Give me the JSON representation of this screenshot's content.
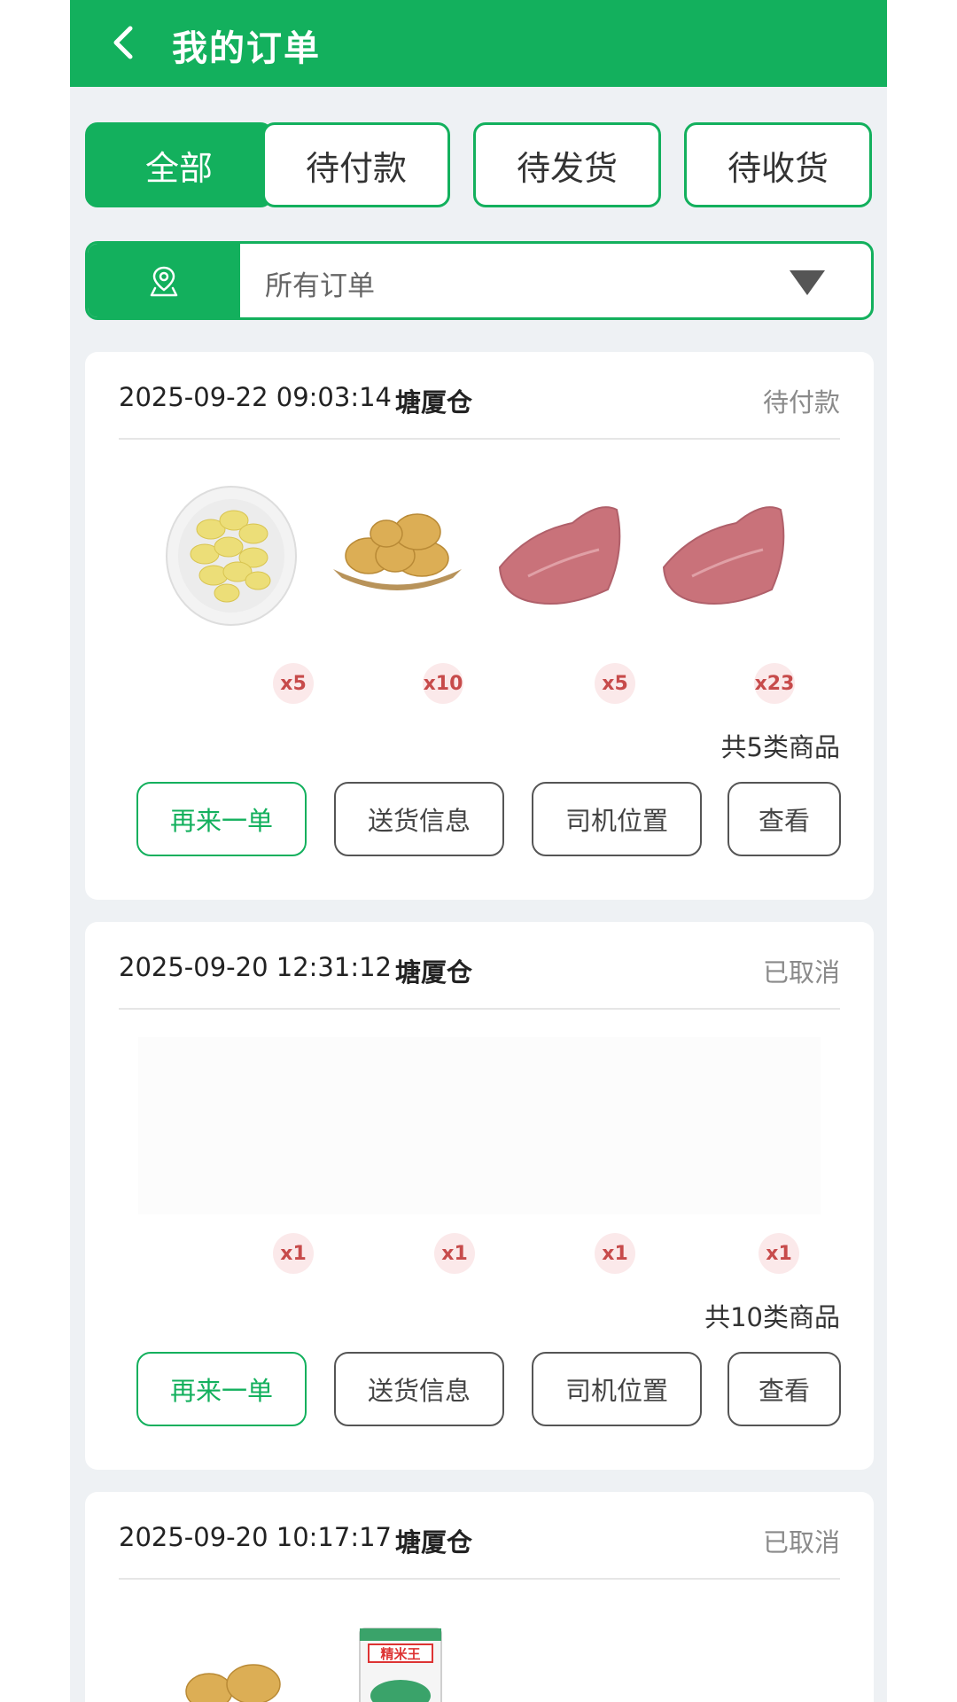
{
  "header": {
    "title": "我的订单"
  },
  "tabs": [
    {
      "label": "全部",
      "active": true
    },
    {
      "label": "待付款",
      "active": false
    },
    {
      "label": "待发货",
      "active": false
    },
    {
      "label": "待收货",
      "active": false
    }
  ],
  "filter": {
    "label": "所有订单"
  },
  "actions": {
    "reorder": "再来一单",
    "delivery": "送货信息",
    "driver": "司机位置",
    "view": "查看"
  },
  "orders": [
    {
      "time": "2025-09-22 09:03:14",
      "warehouse": "塘厦仓",
      "status": "待付款",
      "items": [
        {
          "icon": "sliced-potato-plate",
          "qty": "x5"
        },
        {
          "icon": "potatoes-basket",
          "qty": "x10"
        },
        {
          "icon": "pork-meat",
          "qty": "x5"
        },
        {
          "icon": "pork-meat",
          "qty": "x23"
        }
      ],
      "summary": "共5类商品"
    },
    {
      "time": "2025-09-20 12:31:12",
      "warehouse": "塘厦仓",
      "status": "已取消",
      "items": [
        {
          "icon": "blank-image",
          "qty": "x1"
        },
        {
          "icon": "blank-image",
          "qty": "x1"
        },
        {
          "icon": "blank-image",
          "qty": "x1"
        },
        {
          "icon": "blank-image",
          "qty": "x1"
        }
      ],
      "summary": "共10类商品"
    },
    {
      "time": "2025-09-20 10:17:17",
      "warehouse": "塘厦仓",
      "status": "已取消",
      "items": [
        {
          "icon": "potatoes-basket"
        },
        {
          "icon": "rice-bag",
          "brand": "精米王"
        }
      ]
    }
  ],
  "colors": {
    "accent": "#13b05d",
    "qty_bg": "#fbe9ea",
    "qty_text": "#c74b4b",
    "page_bg": "#eef1f4"
  }
}
